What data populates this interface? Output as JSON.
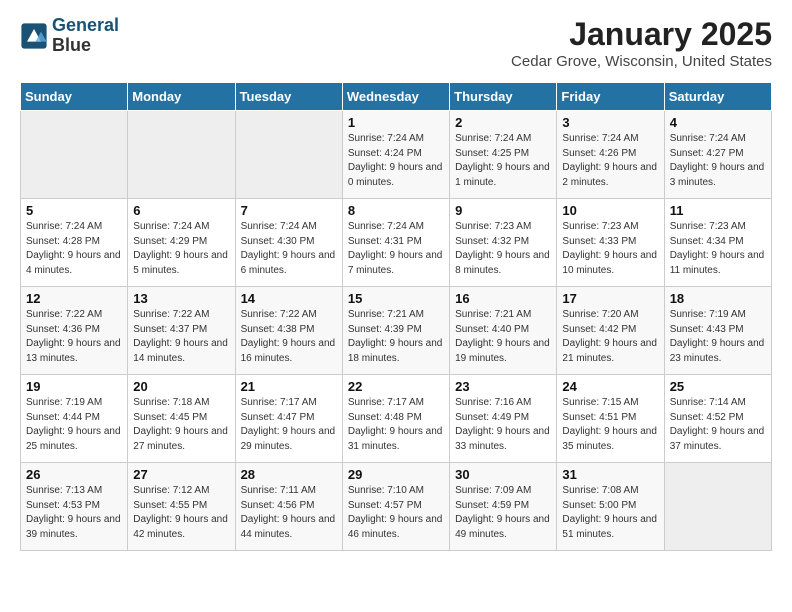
{
  "header": {
    "logo_line1": "General",
    "logo_line2": "Blue",
    "month": "January 2025",
    "location": "Cedar Grove, Wisconsin, United States"
  },
  "days_of_week": [
    "Sunday",
    "Monday",
    "Tuesday",
    "Wednesday",
    "Thursday",
    "Friday",
    "Saturday"
  ],
  "weeks": [
    [
      {
        "day": "",
        "sunrise": "",
        "sunset": "",
        "daylight": ""
      },
      {
        "day": "",
        "sunrise": "",
        "sunset": "",
        "daylight": ""
      },
      {
        "day": "",
        "sunrise": "",
        "sunset": "",
        "daylight": ""
      },
      {
        "day": "1",
        "sunrise": "Sunrise: 7:24 AM",
        "sunset": "Sunset: 4:24 PM",
        "daylight": "Daylight: 9 hours and 0 minutes."
      },
      {
        "day": "2",
        "sunrise": "Sunrise: 7:24 AM",
        "sunset": "Sunset: 4:25 PM",
        "daylight": "Daylight: 9 hours and 1 minute."
      },
      {
        "day": "3",
        "sunrise": "Sunrise: 7:24 AM",
        "sunset": "Sunset: 4:26 PM",
        "daylight": "Daylight: 9 hours and 2 minutes."
      },
      {
        "day": "4",
        "sunrise": "Sunrise: 7:24 AM",
        "sunset": "Sunset: 4:27 PM",
        "daylight": "Daylight: 9 hours and 3 minutes."
      }
    ],
    [
      {
        "day": "5",
        "sunrise": "Sunrise: 7:24 AM",
        "sunset": "Sunset: 4:28 PM",
        "daylight": "Daylight: 9 hours and 4 minutes."
      },
      {
        "day": "6",
        "sunrise": "Sunrise: 7:24 AM",
        "sunset": "Sunset: 4:29 PM",
        "daylight": "Daylight: 9 hours and 5 minutes."
      },
      {
        "day": "7",
        "sunrise": "Sunrise: 7:24 AM",
        "sunset": "Sunset: 4:30 PM",
        "daylight": "Daylight: 9 hours and 6 minutes."
      },
      {
        "day": "8",
        "sunrise": "Sunrise: 7:24 AM",
        "sunset": "Sunset: 4:31 PM",
        "daylight": "Daylight: 9 hours and 7 minutes."
      },
      {
        "day": "9",
        "sunrise": "Sunrise: 7:23 AM",
        "sunset": "Sunset: 4:32 PM",
        "daylight": "Daylight: 9 hours and 8 minutes."
      },
      {
        "day": "10",
        "sunrise": "Sunrise: 7:23 AM",
        "sunset": "Sunset: 4:33 PM",
        "daylight": "Daylight: 9 hours and 10 minutes."
      },
      {
        "day": "11",
        "sunrise": "Sunrise: 7:23 AM",
        "sunset": "Sunset: 4:34 PM",
        "daylight": "Daylight: 9 hours and 11 minutes."
      }
    ],
    [
      {
        "day": "12",
        "sunrise": "Sunrise: 7:22 AM",
        "sunset": "Sunset: 4:36 PM",
        "daylight": "Daylight: 9 hours and 13 minutes."
      },
      {
        "day": "13",
        "sunrise": "Sunrise: 7:22 AM",
        "sunset": "Sunset: 4:37 PM",
        "daylight": "Daylight: 9 hours and 14 minutes."
      },
      {
        "day": "14",
        "sunrise": "Sunrise: 7:22 AM",
        "sunset": "Sunset: 4:38 PM",
        "daylight": "Daylight: 9 hours and 16 minutes."
      },
      {
        "day": "15",
        "sunrise": "Sunrise: 7:21 AM",
        "sunset": "Sunset: 4:39 PM",
        "daylight": "Daylight: 9 hours and 18 minutes."
      },
      {
        "day": "16",
        "sunrise": "Sunrise: 7:21 AM",
        "sunset": "Sunset: 4:40 PM",
        "daylight": "Daylight: 9 hours and 19 minutes."
      },
      {
        "day": "17",
        "sunrise": "Sunrise: 7:20 AM",
        "sunset": "Sunset: 4:42 PM",
        "daylight": "Daylight: 9 hours and 21 minutes."
      },
      {
        "day": "18",
        "sunrise": "Sunrise: 7:19 AM",
        "sunset": "Sunset: 4:43 PM",
        "daylight": "Daylight: 9 hours and 23 minutes."
      }
    ],
    [
      {
        "day": "19",
        "sunrise": "Sunrise: 7:19 AM",
        "sunset": "Sunset: 4:44 PM",
        "daylight": "Daylight: 9 hours and 25 minutes."
      },
      {
        "day": "20",
        "sunrise": "Sunrise: 7:18 AM",
        "sunset": "Sunset: 4:45 PM",
        "daylight": "Daylight: 9 hours and 27 minutes."
      },
      {
        "day": "21",
        "sunrise": "Sunrise: 7:17 AM",
        "sunset": "Sunset: 4:47 PM",
        "daylight": "Daylight: 9 hours and 29 minutes."
      },
      {
        "day": "22",
        "sunrise": "Sunrise: 7:17 AM",
        "sunset": "Sunset: 4:48 PM",
        "daylight": "Daylight: 9 hours and 31 minutes."
      },
      {
        "day": "23",
        "sunrise": "Sunrise: 7:16 AM",
        "sunset": "Sunset: 4:49 PM",
        "daylight": "Daylight: 9 hours and 33 minutes."
      },
      {
        "day": "24",
        "sunrise": "Sunrise: 7:15 AM",
        "sunset": "Sunset: 4:51 PM",
        "daylight": "Daylight: 9 hours and 35 minutes."
      },
      {
        "day": "25",
        "sunrise": "Sunrise: 7:14 AM",
        "sunset": "Sunset: 4:52 PM",
        "daylight": "Daylight: 9 hours and 37 minutes."
      }
    ],
    [
      {
        "day": "26",
        "sunrise": "Sunrise: 7:13 AM",
        "sunset": "Sunset: 4:53 PM",
        "daylight": "Daylight: 9 hours and 39 minutes."
      },
      {
        "day": "27",
        "sunrise": "Sunrise: 7:12 AM",
        "sunset": "Sunset: 4:55 PM",
        "daylight": "Daylight: 9 hours and 42 minutes."
      },
      {
        "day": "28",
        "sunrise": "Sunrise: 7:11 AM",
        "sunset": "Sunset: 4:56 PM",
        "daylight": "Daylight: 9 hours and 44 minutes."
      },
      {
        "day": "29",
        "sunrise": "Sunrise: 7:10 AM",
        "sunset": "Sunset: 4:57 PM",
        "daylight": "Daylight: 9 hours and 46 minutes."
      },
      {
        "day": "30",
        "sunrise": "Sunrise: 7:09 AM",
        "sunset": "Sunset: 4:59 PM",
        "daylight": "Daylight: 9 hours and 49 minutes."
      },
      {
        "day": "31",
        "sunrise": "Sunrise: 7:08 AM",
        "sunset": "Sunset: 5:00 PM",
        "daylight": "Daylight: 9 hours and 51 minutes."
      },
      {
        "day": "",
        "sunrise": "",
        "sunset": "",
        "daylight": ""
      }
    ]
  ]
}
